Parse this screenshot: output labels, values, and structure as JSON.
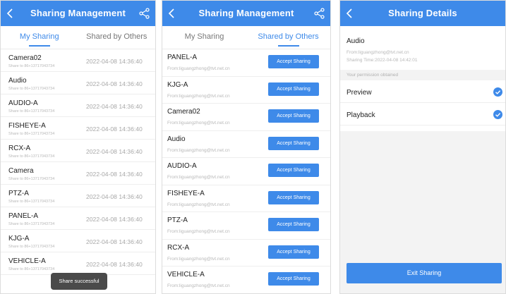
{
  "colors": {
    "accent": "#3e8ae9",
    "toast_bg": "#4a4a4a",
    "divider": "#eeeeee"
  },
  "icons": {
    "back": "chevron-left-icon",
    "share": "share-icon",
    "check": "check-circle-icon"
  },
  "panel1": {
    "title": "Sharing Management",
    "tabs": [
      "My Sharing",
      "Shared by Others"
    ],
    "active_tab": 0,
    "items": [
      {
        "name": "Camera02",
        "sub": "Share to 86+13717043734",
        "time": "2022-04-08 14:36:40"
      },
      {
        "name": "Audio",
        "sub": "Share to 86+13717043734",
        "time": "2022-04-08 14:36:40"
      },
      {
        "name": "AUDIO-A",
        "sub": "Share to 86+13717043734",
        "time": "2022-04-08 14:36:40"
      },
      {
        "name": "FISHEYE-A",
        "sub": "Share to 86+13717043734",
        "time": "2022-04-08 14:36:40"
      },
      {
        "name": "RCX-A",
        "sub": "Share to 86+13717043734",
        "time": "2022-04-08 14:36:40"
      },
      {
        "name": "Camera",
        "sub": "Share to 86+13717043734",
        "time": "2022-04-08 14:36:40"
      },
      {
        "name": "PTZ-A",
        "sub": "Share to 86+13717043734",
        "time": "2022-04-08 14:36:40"
      },
      {
        "name": "PANEL-A",
        "sub": "Share to 86+13717043734",
        "time": "2022-04-08 14:36:40"
      },
      {
        "name": "KJG-A",
        "sub": "Share to 86+13717043734",
        "time": "2022-04-08 14:36:40"
      },
      {
        "name": "VEHICLE-A",
        "sub": "Share to 86+13717043734",
        "time": "2022-04-08 14:36:40"
      }
    ],
    "toast": "Share successful"
  },
  "panel2": {
    "title": "Sharing Management",
    "tabs": [
      "My Sharing",
      "Shared by Others"
    ],
    "active_tab": 1,
    "accept_label": "Accept Sharing",
    "items": [
      {
        "name": "PANEL-A",
        "from": "From:liguangzhong@tvt.net.cn"
      },
      {
        "name": "KJG-A",
        "from": "From:liguangzhong@tvt.net.cn"
      },
      {
        "name": "Camera02",
        "from": "From:liguangzhong@tvt.net.cn"
      },
      {
        "name": "Audio",
        "from": "From:liguangzhong@tvt.net.cn"
      },
      {
        "name": "AUDIO-A",
        "from": "From:liguangzhong@tvt.net.cn"
      },
      {
        "name": "FISHEYE-A",
        "from": "From:liguangzhong@tvt.net.cn"
      },
      {
        "name": "PTZ-A",
        "from": "From:liguangzhong@tvt.net.cn"
      },
      {
        "name": "RCX-A",
        "from": "From:liguangzhong@tvt.net.cn"
      },
      {
        "name": "VEHICLE-A",
        "from": "From:liguangzhong@tvt.net.cn"
      }
    ]
  },
  "panel3": {
    "title": "Sharing Details",
    "device_name": "Audio",
    "from": "From:liguangzhong@tvt.net.cn",
    "sharing_time": "Sharing Time:2022-04-08 14:42:01",
    "permission_header": "Your permission obtained",
    "permissions": [
      {
        "label": "Preview",
        "checked": true
      },
      {
        "label": "Playback",
        "checked": true
      }
    ],
    "exit_label": "Exit Sharing"
  }
}
